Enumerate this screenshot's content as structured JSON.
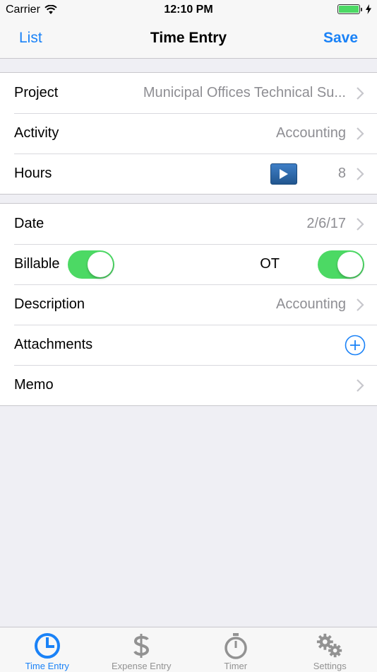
{
  "status_bar": {
    "carrier": "Carrier",
    "time": "12:10 PM",
    "battery_level": 1.0
  },
  "nav": {
    "back_label": "List",
    "title": "Time Entry",
    "save_label": "Save"
  },
  "rows": {
    "project": {
      "label": "Project",
      "value": "Municipal Offices Technical Su..."
    },
    "activity": {
      "label": "Activity",
      "value": "Accounting"
    },
    "hours": {
      "label": "Hours",
      "value": "8"
    },
    "date": {
      "label": "Date",
      "value": "2/6/17"
    },
    "billable": {
      "label": "Billable",
      "on": true
    },
    "ot": {
      "label": "OT",
      "on": true
    },
    "description": {
      "label": "Description",
      "value": "Accounting"
    },
    "attachments": {
      "label": "Attachments"
    },
    "memo": {
      "label": "Memo"
    }
  },
  "tabs": [
    {
      "label": "Time Entry",
      "icon": "clock-icon",
      "active": true
    },
    {
      "label": "Expense Entry",
      "icon": "dollar-icon",
      "active": false
    },
    {
      "label": "Timer",
      "icon": "stopwatch-icon",
      "active": false
    },
    {
      "label": "Settings",
      "icon": "gears-icon",
      "active": false
    }
  ],
  "colors": {
    "accent": "#1a82f7",
    "toggle_on": "#4cd964",
    "background": "#efeff4",
    "secondary_text": "#8e8e93"
  }
}
